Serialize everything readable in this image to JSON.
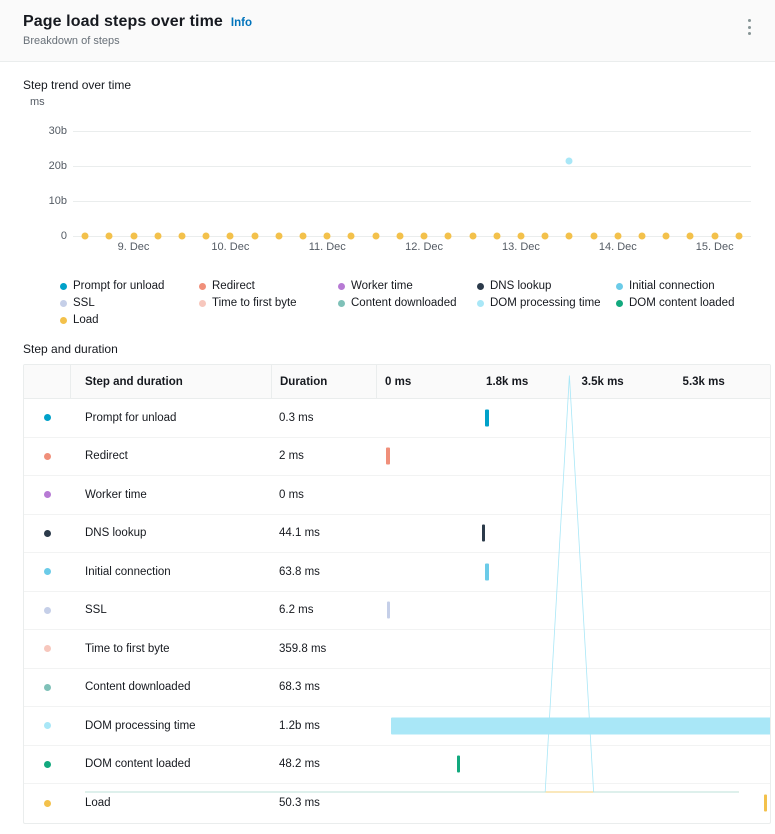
{
  "header": {
    "title": "Page load steps over time",
    "info_label": "Info",
    "subtitle": "Breakdown of steps",
    "menu_icon": "kebab-menu-icon"
  },
  "chart_section": {
    "caption": "Step trend over time"
  },
  "table_section": {
    "caption": "Step and duration",
    "columns": {
      "step": "Step and duration",
      "duration": "Duration"
    },
    "axis_ticks": [
      "0 ms",
      "1.8k ms",
      "3.5k ms",
      "5.3k ms"
    ],
    "axis_tick_values": [
      0,
      1800,
      3500,
      5300
    ]
  },
  "series_colors": {
    "prompt_for_unload": "#00a1c9",
    "redirect": "#f08f7a",
    "worker_time": "#b77ad4",
    "dns_lookup": "#2b3a4a",
    "initial_connection": "#6bcbe8",
    "ssl": "#c5cfe8",
    "time_to_first_byte": "#f7c7bd",
    "content_downloaded": "#7fc1b8",
    "dom_processing_time": "#a9e7f7",
    "dom_content_loaded": "#12a97e",
    "load": "#f3c14b"
  },
  "legend": [
    {
      "label": "Prompt for unload",
      "color": "#00a1c9"
    },
    {
      "label": "Redirect",
      "color": "#f08f7a"
    },
    {
      "label": "Worker time",
      "color": "#b77ad4"
    },
    {
      "label": "DNS lookup",
      "color": "#2b3a4a"
    },
    {
      "label": "Initial connection",
      "color": "#6bcbe8"
    },
    {
      "label": "SSL",
      "color": "#c5cfe8"
    },
    {
      "label": "Time to first byte",
      "color": "#f7c7bd"
    },
    {
      "label": "Content downloaded",
      "color": "#7fc1b8"
    },
    {
      "label": "DOM processing time",
      "color": "#a9e7f7"
    },
    {
      "label": "DOM content loaded",
      "color": "#12a97e"
    },
    {
      "label": "Load",
      "color": "#f3c14b"
    }
  ],
  "rows": [
    {
      "step": "Prompt for unload",
      "duration": "0.3 ms",
      "color": "#00a1c9",
      "bar_start": 1800,
      "bar_end": 1860
    },
    {
      "step": "Redirect",
      "duration": "2 ms",
      "color": "#f08f7a",
      "bar_start": 40,
      "bar_end": 100
    },
    {
      "step": "Worker time",
      "duration": "0 ms",
      "color": "#b77ad4",
      "bar_start": 0,
      "bar_end": 0
    },
    {
      "step": "DNS lookup",
      "duration": "44.1 ms",
      "color": "#2b3a4a",
      "bar_start": 1740,
      "bar_end": 1800
    },
    {
      "step": "Initial connection",
      "duration": "63.8 ms",
      "color": "#6bcbe8",
      "bar_start": 1800,
      "bar_end": 1865
    },
    {
      "step": "SSL",
      "duration": "6.2 ms",
      "color": "#c5cfe8",
      "bar_start": 50,
      "bar_end": 105
    },
    {
      "step": "Time to first byte",
      "duration": "359.8 ms",
      "color": "#f7c7bd",
      "bar_start": 0,
      "bar_end": 0
    },
    {
      "step": "Content downloaded",
      "duration": "68.3 ms",
      "color": "#7fc1b8",
      "bar_start": 0,
      "bar_end": 0
    },
    {
      "step": "DOM processing time",
      "duration": "1.2b ms",
      "color": "#a9e7f7",
      "bar_start": 120,
      "bar_end": 6880
    },
    {
      "step": "DOM content loaded",
      "duration": "48.2 ms",
      "color": "#12a97e",
      "bar_start": 1290,
      "bar_end": 1350
    },
    {
      "step": "Load",
      "duration": "50.3 ms",
      "color": "#f3c14b",
      "bar_start": 6750,
      "bar_end": 6810
    }
  ],
  "chart_data": {
    "type": "line",
    "title": "Step trend over time",
    "xlabel": "",
    "ylabel": "ms",
    "ylim": [
      0,
      35000000000
    ],
    "ytick_labels": [
      "0",
      "10b",
      "20b",
      "30b"
    ],
    "ytick_values": [
      0,
      10000000000,
      20000000000,
      30000000000
    ],
    "grid": true,
    "legend_position": "bottom",
    "xtick_labels": [
      "9. Dec",
      "10. Dec",
      "11. Dec",
      "12. Dec",
      "13. Dec",
      "14. Dec",
      "15. Dec"
    ],
    "xtick_indices": [
      2,
      6,
      10,
      14,
      18,
      22,
      26
    ],
    "x": [
      0,
      1,
      2,
      3,
      4,
      5,
      6,
      7,
      8,
      9,
      10,
      11,
      12,
      13,
      14,
      15,
      16,
      17,
      18,
      19,
      20,
      21,
      22,
      23,
      24,
      25,
      26,
      27
    ],
    "series": [
      {
        "name": "Load",
        "color": "#f3c14b",
        "marker": "circle",
        "values": [
          0,
          0,
          0,
          0,
          0,
          0,
          0,
          0,
          0,
          0,
          0,
          0,
          0,
          0,
          0,
          0,
          0,
          0,
          0,
          0,
          0,
          0,
          0,
          0,
          0,
          0,
          0,
          0
        ]
      },
      {
        "name": "DOM processing time",
        "color": "#a9e7f7",
        "marker": "circle",
        "values": [
          0,
          0,
          0,
          0,
          0,
          0,
          0,
          0,
          0,
          0,
          0,
          0,
          0,
          0,
          0,
          0,
          0,
          0,
          0,
          0,
          21500000000,
          0,
          0,
          0,
          0,
          0,
          0,
          0
        ]
      }
    ]
  }
}
